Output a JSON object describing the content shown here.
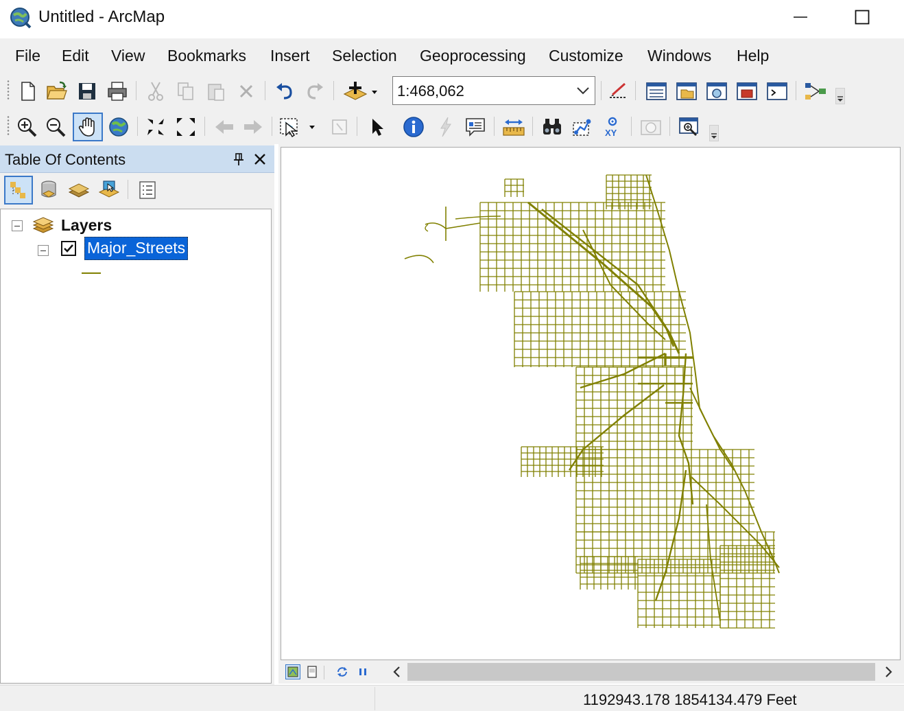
{
  "window": {
    "title": "Untitled - ArcMap",
    "app_icon": "arcmap-globe-icon",
    "controls": [
      "minimize-icon",
      "maximize-icon"
    ]
  },
  "menu": {
    "items": [
      "File",
      "Edit",
      "View",
      "Bookmarks",
      "Insert",
      "Selection",
      "Geoprocessing",
      "Customize",
      "Windows",
      "Help"
    ]
  },
  "standard_toolbar": {
    "tools": [
      "new-document-icon",
      "open-icon",
      "save-icon",
      "print-icon",
      "cut-icon",
      "copy-icon",
      "paste-icon",
      "delete-icon",
      "undo-icon",
      "redo-icon",
      "add-data-icon"
    ],
    "map_scale": "1:468,062",
    "right_tools": [
      "editor-toolbar-icon",
      "table-of-contents-icon",
      "catalog-window-icon",
      "search-window-icon",
      "arctoolbox-icon",
      "python-window-icon",
      "modelbuilder-icon"
    ]
  },
  "tools_toolbar": {
    "tools": [
      "zoom-in-icon",
      "zoom-out-icon",
      "pan-icon",
      "full-extent-icon",
      "fixed-zoom-in-icon",
      "fixed-zoom-out-icon",
      "go-back-icon",
      "go-forward-icon",
      "select-features-icon",
      "clear-selection-icon",
      "select-elements-icon",
      "identify-icon",
      "hyperlink-icon",
      "html-popup-icon",
      "measure-icon",
      "find-icon",
      "find-route-icon",
      "go-to-xy-icon",
      "time-slider-icon",
      "create-viewer-window-icon"
    ],
    "active_tool": "pan-icon"
  },
  "toc": {
    "title": "Table Of Contents",
    "tabs": [
      "list-by-drawing-order-icon",
      "list-by-source-icon",
      "list-by-visibility-icon",
      "list-by-selection-icon",
      "options-icon"
    ],
    "data_frame": "Layers",
    "layers": [
      {
        "name": "Major_Streets",
        "checked": true,
        "selected": true,
        "symbol_color": "#808000"
      }
    ]
  },
  "map": {
    "layer_color": "#808000",
    "bottom_controls": [
      "data-view-icon",
      "layout-view-icon",
      "refresh-icon",
      "pause-drawing-icon"
    ]
  },
  "status": {
    "coordinates": "1192943.178  1854134.479 Feet"
  }
}
